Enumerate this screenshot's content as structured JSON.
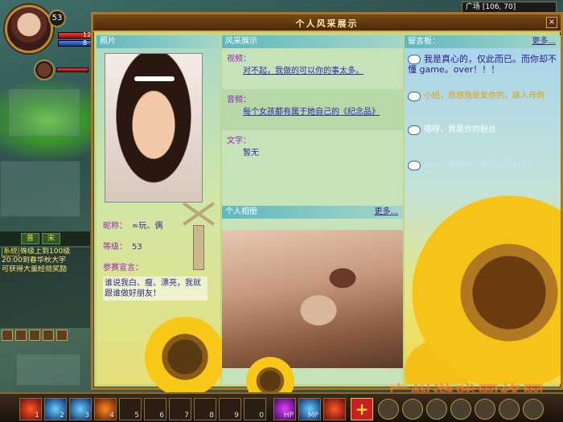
{
  "player": {
    "level": "53",
    "hp": "12",
    "mp": "8"
  },
  "location": "广场 [106, 70]",
  "window": {
    "title": "个人风采展示",
    "close": "×"
  },
  "profile": {
    "photo_header": "照片",
    "nickname_label": "昵称：",
    "nickname": "≈玩、偶",
    "level_label": "等级：",
    "level": "53",
    "declaration_label": "参赛宣言：",
    "declaration": "谁说我白、瘦、漂亮，我就跟谁做好朋友！"
  },
  "show": {
    "header": "风采展示",
    "video_label": "视频：",
    "video_value": "对不起，我做的可以你的事太多。",
    "audio_label": "音频：",
    "audio_value": "每个女孩都有属于她自己的《纪念品》",
    "text_label": "文字：",
    "text_value": "暂无",
    "album_header": "个人相册",
    "album_more": "更多..."
  },
  "board": {
    "header": "留言板：",
    "more": "更多...",
    "messages": [
      {
        "text": "我是真心的，仅此而已。而你却不懂 game。over！！！"
      },
      {
        "text": "小妞，我想我是爱你的，嫁入母倒"
      },
      {
        "text": "嗯呀，我是你的粉丝"
      },
      {
        "text": "mm，我呢吧，我的id是5479"
      }
    ]
  },
  "chat": {
    "tabs": [
      "普",
      "宋"
    ],
    "lines": [
      {
        "tag": "系统",
        "text": "殊级上到100级"
      },
      {
        "tag": "",
        "text": "20:00到春华秋大宇"
      },
      {
        "tag": "",
        "text": "可获得大量经验奖励"
      }
    ]
  },
  "skillbar": {
    "slots": [
      "1",
      "2",
      "3",
      "4",
      "5",
      "6",
      "7",
      "8",
      "9",
      "0"
    ],
    "potions": [
      "HP",
      "MP"
    ],
    "plus": "+"
  },
  "watermark": "广州游戏网络网"
}
